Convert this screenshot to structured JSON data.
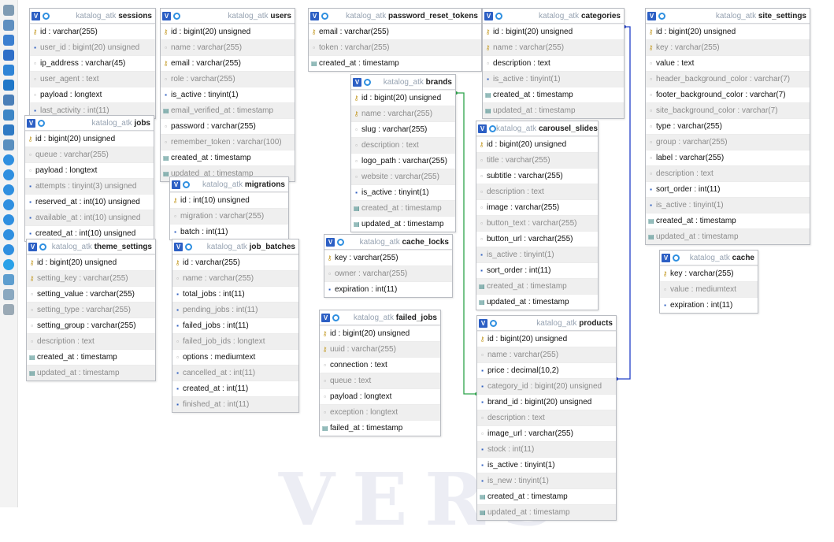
{
  "icon_glyphs": {
    "pk": "⚷",
    "num": "▪",
    "text": "▫",
    "time": "▤",
    "toggle": "V"
  },
  "colors": {
    "relation": "#2ca34a",
    "relation_blue": "#2240c8",
    "toolbar": "#f3f3f3",
    "header_toggle": "#2c5fc4"
  },
  "toolbar": {
    "icons": [
      "back-icon",
      "fullscreen-icon",
      "grid-icon",
      "page-icon",
      "edit-icon",
      "save-icon",
      "print-icon",
      "export-icon",
      "calendar-icon",
      "relation-icon",
      "add-icon",
      "hide-icon",
      "show-icon",
      "help-icon",
      "toggle-icon",
      "refresh-icon",
      "help-circle-icon",
      "active-icon",
      "save-small-icon",
      "info-icon",
      "anchor-icon"
    ]
  },
  "watermark": "VERS",
  "tables": [
    {
      "prefix": "katalog_atk",
      "name": "sessions",
      "columns": [
        {
          "text": "id : varchar(255)",
          "icon": "pk"
        },
        {
          "text": "user_id : bigint(20) unsigned",
          "icon": "num",
          "dim": true
        },
        {
          "text": "ip_address : varchar(45)",
          "icon": "text"
        },
        {
          "text": "user_agent : text",
          "icon": "text",
          "dim": true
        },
        {
          "text": "payload : longtext",
          "icon": "text"
        },
        {
          "text": "last_activity : int(11)",
          "icon": "num",
          "dim": true
        }
      ]
    },
    {
      "prefix": "katalog_atk",
      "name": "users",
      "columns": [
        {
          "text": "id : bigint(20) unsigned",
          "icon": "pk"
        },
        {
          "text": "name : varchar(255)",
          "icon": "text",
          "dim": true
        },
        {
          "text": "email : varchar(255)",
          "icon": "pk"
        },
        {
          "text": "role : varchar(255)",
          "icon": "text",
          "dim": true
        },
        {
          "text": "is_active : tinyint(1)",
          "icon": "num"
        },
        {
          "text": "email_verified_at : timestamp",
          "icon": "time",
          "dim": true
        },
        {
          "text": "password : varchar(255)",
          "icon": "text"
        },
        {
          "text": "remember_token : varchar(100)",
          "icon": "text",
          "dim": true
        },
        {
          "text": "created_at : timestamp",
          "icon": "time"
        },
        {
          "text": "updated_at : timestamp",
          "icon": "time",
          "dim": true
        }
      ]
    },
    {
      "prefix": "katalog_atk",
      "name": "password_reset_tokens",
      "columns": [
        {
          "text": "email : varchar(255)",
          "icon": "pk"
        },
        {
          "text": "token : varchar(255)",
          "icon": "text",
          "dim": true
        },
        {
          "text": "created_at : timestamp",
          "icon": "time"
        }
      ]
    },
    {
      "prefix": "katalog_atk",
      "name": "categories",
      "columns": [
        {
          "text": "id : bigint(20) unsigned",
          "icon": "pk"
        },
        {
          "text": "name : varchar(255)",
          "icon": "pk",
          "dim": true
        },
        {
          "text": "description : text",
          "icon": "text"
        },
        {
          "text": "is_active : tinyint(1)",
          "icon": "num",
          "dim": true
        },
        {
          "text": "created_at : timestamp",
          "icon": "time"
        },
        {
          "text": "updated_at : timestamp",
          "icon": "time",
          "dim": true
        }
      ]
    },
    {
      "prefix": "katalog_atk",
      "name": "site_settings",
      "columns": [
        {
          "text": "id : bigint(20) unsigned",
          "icon": "pk"
        },
        {
          "text": "key : varchar(255)",
          "icon": "pk",
          "dim": true
        },
        {
          "text": "value : text",
          "icon": "text"
        },
        {
          "text": "header_background_color : varchar(7)",
          "icon": "text",
          "dim": true
        },
        {
          "text": "footer_background_color : varchar(7)",
          "icon": "text"
        },
        {
          "text": "site_background_color : varchar(7)",
          "icon": "text",
          "dim": true
        },
        {
          "text": "type : varchar(255)",
          "icon": "text"
        },
        {
          "text": "group : varchar(255)",
          "icon": "text",
          "dim": true
        },
        {
          "text": "label : varchar(255)",
          "icon": "text"
        },
        {
          "text": "description : text",
          "icon": "text",
          "dim": true
        },
        {
          "text": "sort_order : int(11)",
          "icon": "num"
        },
        {
          "text": "is_active : tinyint(1)",
          "icon": "num",
          "dim": true
        },
        {
          "text": "created_at : timestamp",
          "icon": "time"
        },
        {
          "text": "updated_at : timestamp",
          "icon": "time",
          "dim": true
        }
      ]
    },
    {
      "prefix": "katalog_atk",
      "name": "jobs",
      "columns": [
        {
          "text": "id : bigint(20) unsigned",
          "icon": "pk"
        },
        {
          "text": "queue : varchar(255)",
          "icon": "text",
          "dim": true
        },
        {
          "text": "payload : longtext",
          "icon": "text"
        },
        {
          "text": "attempts : tinyint(3) unsigned",
          "icon": "num",
          "dim": true
        },
        {
          "text": "reserved_at : int(10) unsigned",
          "icon": "num"
        },
        {
          "text": "available_at : int(10) unsigned",
          "icon": "num",
          "dim": true
        },
        {
          "text": "created_at : int(10) unsigned",
          "icon": "num"
        }
      ]
    },
    {
      "prefix": "katalog_atk",
      "name": "brands",
      "columns": [
        {
          "text": "id : bigint(20) unsigned",
          "icon": "pk"
        },
        {
          "text": "name : varchar(255)",
          "icon": "pk",
          "dim": true
        },
        {
          "text": "slug : varchar(255)",
          "icon": "text"
        },
        {
          "text": "description : text",
          "icon": "text",
          "dim": true
        },
        {
          "text": "logo_path : varchar(255)",
          "icon": "text"
        },
        {
          "text": "website : varchar(255)",
          "icon": "text",
          "dim": true
        },
        {
          "text": "is_active : tinyint(1)",
          "icon": "num"
        },
        {
          "text": "created_at : timestamp",
          "icon": "time",
          "dim": true
        },
        {
          "text": "updated_at : timestamp",
          "icon": "time"
        }
      ]
    },
    {
      "prefix": "katalog_atk",
      "name": "carousel_slides",
      "columns": [
        {
          "text": "id : bigint(20) unsigned",
          "icon": "pk"
        },
        {
          "text": "title : varchar(255)",
          "icon": "text",
          "dim": true
        },
        {
          "text": "subtitle : varchar(255)",
          "icon": "text"
        },
        {
          "text": "description : text",
          "icon": "text",
          "dim": true
        },
        {
          "text": "image : varchar(255)",
          "icon": "text"
        },
        {
          "text": "button_text : varchar(255)",
          "icon": "text",
          "dim": true
        },
        {
          "text": "button_url : varchar(255)",
          "icon": "text"
        },
        {
          "text": "is_active : tinyint(1)",
          "icon": "num",
          "dim": true
        },
        {
          "text": "sort_order : int(11)",
          "icon": "num"
        },
        {
          "text": "created_at : timestamp",
          "icon": "time",
          "dim": true
        },
        {
          "text": "updated_at : timestamp",
          "icon": "time"
        }
      ]
    },
    {
      "prefix": "katalog_atk",
      "name": "migrations",
      "columns": [
        {
          "text": "id : int(10) unsigned",
          "icon": "pk"
        },
        {
          "text": "migration : varchar(255)",
          "icon": "text",
          "dim": true
        },
        {
          "text": "batch : int(11)",
          "icon": "num"
        }
      ]
    },
    {
      "prefix": "katalog_atk",
      "name": "theme_settings",
      "columns": [
        {
          "text": "id : bigint(20) unsigned",
          "icon": "pk"
        },
        {
          "text": "setting_key : varchar(255)",
          "icon": "pk",
          "dim": true
        },
        {
          "text": "setting_value : varchar(255)",
          "icon": "text"
        },
        {
          "text": "setting_type : varchar(255)",
          "icon": "text",
          "dim": true
        },
        {
          "text": "setting_group : varchar(255)",
          "icon": "text"
        },
        {
          "text": "description : text",
          "icon": "text",
          "dim": true
        },
        {
          "text": "created_at : timestamp",
          "icon": "time"
        },
        {
          "text": "updated_at : timestamp",
          "icon": "time",
          "dim": true
        }
      ]
    },
    {
      "prefix": "katalog_atk",
      "name": "job_batches",
      "columns": [
        {
          "text": "id : varchar(255)",
          "icon": "pk"
        },
        {
          "text": "name : varchar(255)",
          "icon": "text",
          "dim": true
        },
        {
          "text": "total_jobs : int(11)",
          "icon": "num"
        },
        {
          "text": "pending_jobs : int(11)",
          "icon": "num",
          "dim": true
        },
        {
          "text": "failed_jobs : int(11)",
          "icon": "num"
        },
        {
          "text": "failed_job_ids : longtext",
          "icon": "text",
          "dim": true
        },
        {
          "text": "options : mediumtext",
          "icon": "text"
        },
        {
          "text": "cancelled_at : int(11)",
          "icon": "num",
          "dim": true
        },
        {
          "text": "created_at : int(11)",
          "icon": "num"
        },
        {
          "text": "finished_at : int(11)",
          "icon": "num",
          "dim": true
        }
      ]
    },
    {
      "prefix": "katalog_atk",
      "name": "cache_locks",
      "columns": [
        {
          "text": "key : varchar(255)",
          "icon": "pk"
        },
        {
          "text": "owner : varchar(255)",
          "icon": "text",
          "dim": true
        },
        {
          "text": "expiration : int(11)",
          "icon": "num"
        }
      ]
    },
    {
      "prefix": "katalog_atk",
      "name": "cache",
      "columns": [
        {
          "text": "key : varchar(255)",
          "icon": "pk"
        },
        {
          "text": "value : mediumtext",
          "icon": "text",
          "dim": true
        },
        {
          "text": "expiration : int(11)",
          "icon": "num"
        }
      ]
    },
    {
      "prefix": "katalog_atk",
      "name": "failed_jobs",
      "columns": [
        {
          "text": "id : bigint(20) unsigned",
          "icon": "pk"
        },
        {
          "text": "uuid : varchar(255)",
          "icon": "pk",
          "dim": true
        },
        {
          "text": "connection : text",
          "icon": "text"
        },
        {
          "text": "queue : text",
          "icon": "text",
          "dim": true
        },
        {
          "text": "payload : longtext",
          "icon": "text"
        },
        {
          "text": "exception : longtext",
          "icon": "text",
          "dim": true
        },
        {
          "text": "failed_at : timestamp",
          "icon": "time"
        }
      ]
    },
    {
      "prefix": "katalog_atk",
      "name": "products",
      "columns": [
        {
          "text": "id : bigint(20) unsigned",
          "icon": "pk"
        },
        {
          "text": "name : varchar(255)",
          "icon": "text",
          "dim": true
        },
        {
          "text": "price : decimal(10,2)",
          "icon": "num"
        },
        {
          "text": "category_id : bigint(20) unsigned",
          "icon": "num",
          "dim": true
        },
        {
          "text": "brand_id : bigint(20) unsigned",
          "icon": "num"
        },
        {
          "text": "description : text",
          "icon": "text",
          "dim": true
        },
        {
          "text": "image_url : varchar(255)",
          "icon": "text"
        },
        {
          "text": "stock : int(11)",
          "icon": "num",
          "dim": true
        },
        {
          "text": "is_active : tinyint(1)",
          "icon": "num"
        },
        {
          "text": "is_new : tinyint(1)",
          "icon": "num",
          "dim": true
        },
        {
          "text": "created_at : timestamp",
          "icon": "time"
        },
        {
          "text": "updated_at : timestamp",
          "icon": "time",
          "dim": true
        }
      ]
    }
  ]
}
